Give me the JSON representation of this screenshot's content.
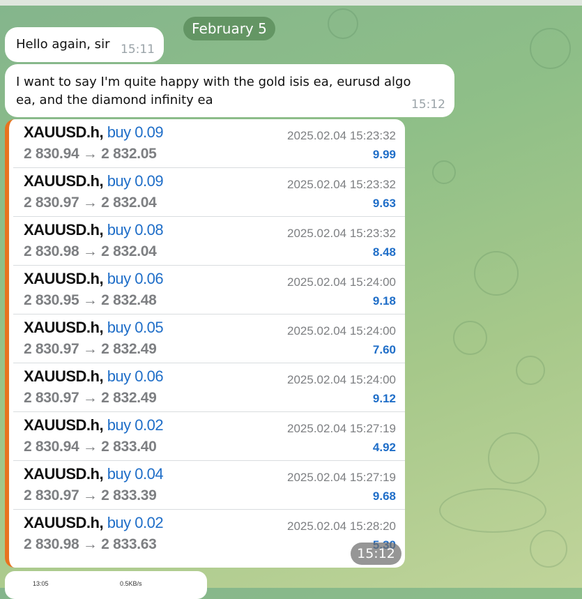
{
  "date_separator": "February 5",
  "messages": [
    {
      "text": "Hello again, sir",
      "time": "15:11"
    },
    {
      "text": "I want to say I'm quite happy with the gold isis ea, eurusd algo ea, and the diamond infinity ea",
      "time": "15:12"
    }
  ],
  "trades": [
    {
      "symbol": "XAUUSD.h,",
      "action": "buy 0.09",
      "from": "2 830.94",
      "to": "2 832.05",
      "datetime": "2025.02.04 15:23:32",
      "profit": "9.99"
    },
    {
      "symbol": "XAUUSD.h,",
      "action": "buy 0.09",
      "from": "2 830.97",
      "to": "2 832.04",
      "datetime": "2025.02.04 15:23:32",
      "profit": "9.63"
    },
    {
      "symbol": "XAUUSD.h,",
      "action": "buy 0.08",
      "from": "2 830.98",
      "to": "2 832.04",
      "datetime": "2025.02.04 15:23:32",
      "profit": "8.48"
    },
    {
      "symbol": "XAUUSD.h,",
      "action": "buy 0.06",
      "from": "2 830.95",
      "to": "2 832.48",
      "datetime": "2025.02.04 15:24:00",
      "profit": "9.18"
    },
    {
      "symbol": "XAUUSD.h,",
      "action": "buy 0.05",
      "from": "2 830.97",
      "to": "2 832.49",
      "datetime": "2025.02.04 15:24:00",
      "profit": "7.60"
    },
    {
      "symbol": "XAUUSD.h,",
      "action": "buy 0.06",
      "from": "2 830.97",
      "to": "2 832.49",
      "datetime": "2025.02.04 15:24:00",
      "profit": "9.12"
    },
    {
      "symbol": "XAUUSD.h,",
      "action": "buy 0.02",
      "from": "2 830.94",
      "to": "2 833.40",
      "datetime": "2025.02.04 15:27:19",
      "profit": "4.92"
    },
    {
      "symbol": "XAUUSD.h,",
      "action": "buy 0.04",
      "from": "2 830.97",
      "to": "2 833.39",
      "datetime": "2025.02.04 15:27:19",
      "profit": "9.68"
    },
    {
      "symbol": "XAUUSD.h,",
      "action": "buy 0.02",
      "from": "2 830.98",
      "to": "2 833.63",
      "datetime": "2025.02.04 15:28:20",
      "profit": "5.30"
    }
  ],
  "arrow": "→",
  "image_time": "15:12",
  "next_image_status": {
    "clock": "13:05",
    "net": "0.5KB/s"
  },
  "colors": {
    "accent_bar": "#e8731f",
    "buy_blue": "#1f6ec8",
    "chat_bg": "#8fbf88"
  }
}
